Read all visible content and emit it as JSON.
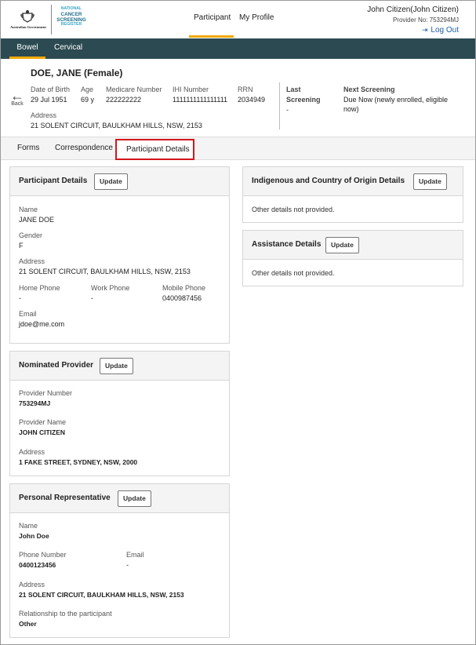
{
  "header": {
    "gov_label": "Australian Government",
    "ncsr_line1": "NATIONAL",
    "ncsr_line2": "CANCER SCREENING",
    "ncsr_line3": "REGISTER",
    "nav": [
      {
        "label": "Participant",
        "active": true
      },
      {
        "label": "My Profile",
        "active": false
      }
    ],
    "user_name": "John Citizen(John Citizen)",
    "provider_no": "Provider No: 753294MJ",
    "logout_label": "Log Out"
  },
  "programs": [
    {
      "label": "Bowel",
      "active": true
    },
    {
      "label": "Cervical",
      "active": false
    }
  ],
  "participant": {
    "back_label": "Back",
    "name": "DOE, JANE (Female)",
    "dob_label": "Date of Birth",
    "dob": "29 Jul 1951",
    "age_label": "Age",
    "age": "69 y",
    "medicare_label": "Medicare Number",
    "medicare": "222222222",
    "ihi_label": "IHI Number",
    "ihi": "1111111111111111",
    "rrn_label": "RRN",
    "rrn": "2034949",
    "address_label": "Address",
    "address": "21 SOLENT CIRCUIT, BAULKHAM HILLS, NSW, 2153",
    "last_screening_label_1": "Last",
    "last_screening_label_2": "Screening",
    "last_screening": "-",
    "next_screening_label": "Next Screening",
    "next_screening_1": "Due Now (newly enrolled, eligible",
    "next_screening_2": "now)"
  },
  "tabs": [
    {
      "label": "Forms"
    },
    {
      "label": "Correspondence"
    },
    {
      "label": "Participant Details",
      "active": true
    }
  ],
  "update_label": "Update",
  "participant_details": {
    "title": "Participant Details",
    "name_label": "Name",
    "name": "JANE DOE",
    "gender_label": "Gender",
    "gender": "F",
    "address_label": "Address",
    "address": "21 SOLENT CIRCUIT, BAULKHAM HILLS, NSW, 2153",
    "home_phone_label": "Home Phone",
    "home_phone": "-",
    "work_phone_label": "Work Phone",
    "work_phone": "-",
    "mobile_phone_label": "Mobile Phone",
    "mobile_phone": "0400987456",
    "email_label": "Email",
    "email": "jdoe@me.com"
  },
  "nominated_provider": {
    "title": "Nominated Provider",
    "provider_number_label": "Provider Number",
    "provider_number": "753294MJ",
    "provider_name_label": "Provider Name",
    "provider_name": "JOHN CITIZEN",
    "address_label": "Address",
    "address": "1 FAKE STREET, SYDNEY, NSW, 2000"
  },
  "personal_representative": {
    "title": "Personal Representative",
    "name_label": "Name",
    "name": "John Doe",
    "phone_label": "Phone Number",
    "phone": "0400123456",
    "email_label": "Email",
    "email": "-",
    "address_label": "Address",
    "address": "21 SOLENT CIRCUIT, BAULKHAM HILLS, NSW, 2153",
    "relationship_label": "Relationship to the participant",
    "relationship": "Other"
  },
  "indigenous": {
    "title": "Indigenous and Country of Origin Details",
    "text": "Other details not provided."
  },
  "assistance": {
    "title": "Assistance Details",
    "text": "Other details not provided."
  },
  "colors": {
    "program_bar": "#2c4a52",
    "accent": "#f2a900",
    "highlight_border": "#d3161b",
    "link": "#1f5fa8"
  }
}
